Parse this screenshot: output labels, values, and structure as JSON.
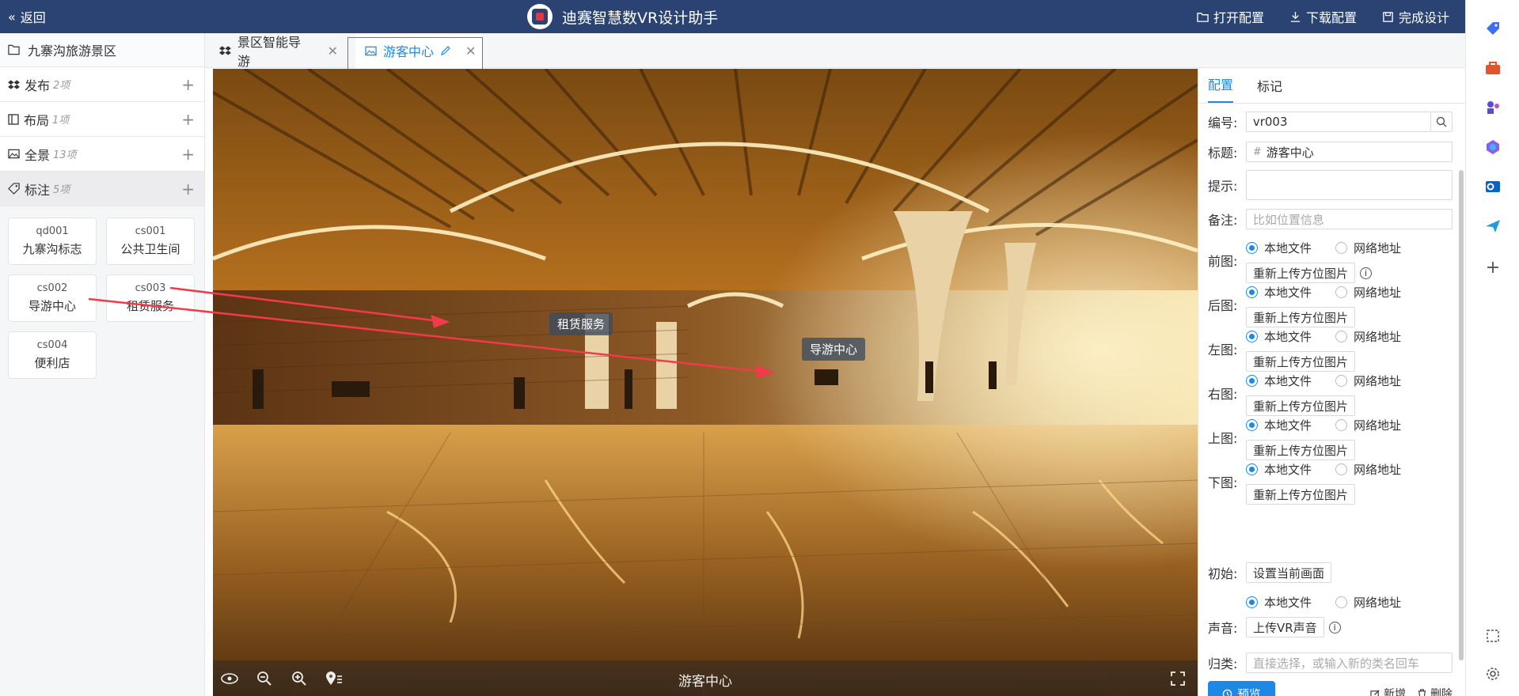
{
  "app": {
    "title": "迪赛智慧数VR设计助手",
    "back_label": "返回",
    "actions": [
      {
        "icon": "folder-open-icon",
        "label": "打开配置"
      },
      {
        "icon": "download-icon",
        "label": "下载配置"
      },
      {
        "icon": "save-icon",
        "label": "完成设计"
      }
    ]
  },
  "sidebar": {
    "root": "九寨沟旅游景区",
    "sections": [
      {
        "label": "发布",
        "count": "2项",
        "icon": "dropbox-icon"
      },
      {
        "label": "布局",
        "count": "1项",
        "icon": "layout-icon"
      },
      {
        "label": "全景",
        "count": "13项",
        "icon": "image-icon"
      },
      {
        "label": "标注",
        "count": "5项",
        "icon": "tag-icon"
      }
    ],
    "markers": [
      {
        "code": "qd001",
        "name": "九寨沟标志"
      },
      {
        "code": "cs001",
        "name": "公共卫生间"
      },
      {
        "code": "cs002",
        "name": "导游中心"
      },
      {
        "code": "cs003",
        "name": "租赁服务"
      },
      {
        "code": "cs004",
        "name": "便利店"
      }
    ]
  },
  "tabs": [
    {
      "label": "景区智能导游",
      "icon": "dropbox-icon"
    },
    {
      "label": "游客中心",
      "icon": "image-icon"
    }
  ],
  "viewer": {
    "title": "游客中心",
    "hotspots": [
      "租赁服务",
      "导游中心"
    ],
    "controls": [
      "rotate-icon",
      "zoom-out-icon",
      "zoom-in-icon",
      "location-list-icon",
      "fullscreen-icon"
    ]
  },
  "panel": {
    "tabs": [
      "配置",
      "标记"
    ],
    "fields": {
      "id_label": "编号:",
      "id_value": "vr003",
      "title_label": "标题:",
      "title_value": "游客中心",
      "hint_label": "提示:",
      "hint_value": "",
      "remark_label": "备注:",
      "remark_placeholder": "比如位置信息",
      "init_label": "初始:",
      "init_button": "设置当前画面",
      "sound_label": "声音:",
      "sound_button": "上传VR声音",
      "category_label": "归类:",
      "category_placeholder": "直接选择，或输入新的类名回车"
    },
    "radio_local": "本地文件",
    "radio_net": "网络地址",
    "upload_label": "重新上传方位图片",
    "faces": [
      "前图:",
      "后图:",
      "左图:",
      "右图:",
      "上图:",
      "下图:"
    ],
    "preview_label": "预览",
    "add_label": "新增",
    "delete_label": "删除"
  },
  "colors": {
    "topbar": "#2a4373",
    "accent": "#1e88e5",
    "highlight": "#ff3b3b"
  }
}
